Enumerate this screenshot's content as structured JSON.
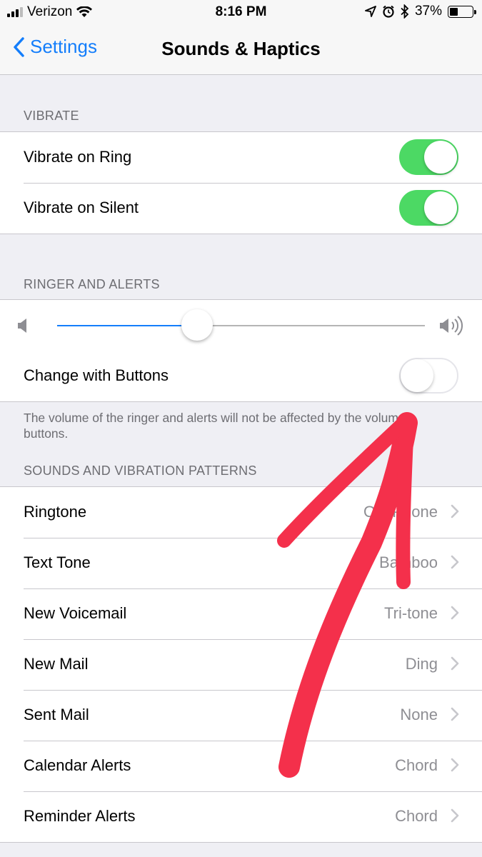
{
  "status_bar": {
    "carrier": "Verizon",
    "time": "8:16 PM",
    "battery_percent_label": "37%",
    "battery_level": 0.37,
    "icons": [
      "signal-icon",
      "wifi-icon",
      "location-icon",
      "alarm-icon",
      "bluetooth-icon",
      "battery-icon"
    ]
  },
  "nav": {
    "back_label": "Settings",
    "title": "Sounds & Haptics"
  },
  "vibrate": {
    "header": "VIBRATE",
    "rows": [
      {
        "label": "Vibrate on Ring",
        "on": true
      },
      {
        "label": "Vibrate on Silent",
        "on": true
      }
    ]
  },
  "ringer": {
    "header": "RINGER AND ALERTS",
    "volume_level": 0.38,
    "change_with_buttons_label": "Change with Buttons",
    "change_with_buttons_on": false,
    "footer": "The volume of the ringer and alerts will not be affected by the volume buttons."
  },
  "patterns": {
    "header": "SOUNDS AND VIBRATION PATTERNS",
    "rows": [
      {
        "label": "Ringtone",
        "value": "Old Phone"
      },
      {
        "label": "Text Tone",
        "value": "Bamboo"
      },
      {
        "label": "New Voicemail",
        "value": "Tri-tone"
      },
      {
        "label": "New Mail",
        "value": "Ding"
      },
      {
        "label": "Sent Mail",
        "value": "None"
      },
      {
        "label": "Calendar Alerts",
        "value": "Chord"
      },
      {
        "label": "Reminder Alerts",
        "value": "Chord"
      }
    ]
  },
  "colors": {
    "accent": "#147efb",
    "toggle_on": "#4cd964",
    "annotation": "#f4304b"
  }
}
